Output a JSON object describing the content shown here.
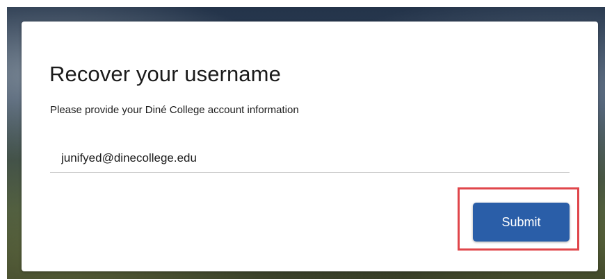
{
  "page": {
    "title": "Recover your username",
    "subtitle": "Please provide your Diné College account information"
  },
  "form": {
    "email_value": "junifyed@dinecollege.edu",
    "submit_label": "Submit"
  },
  "colors": {
    "primary_button": "#2a5ea8",
    "highlight_box": "#e0464b"
  }
}
